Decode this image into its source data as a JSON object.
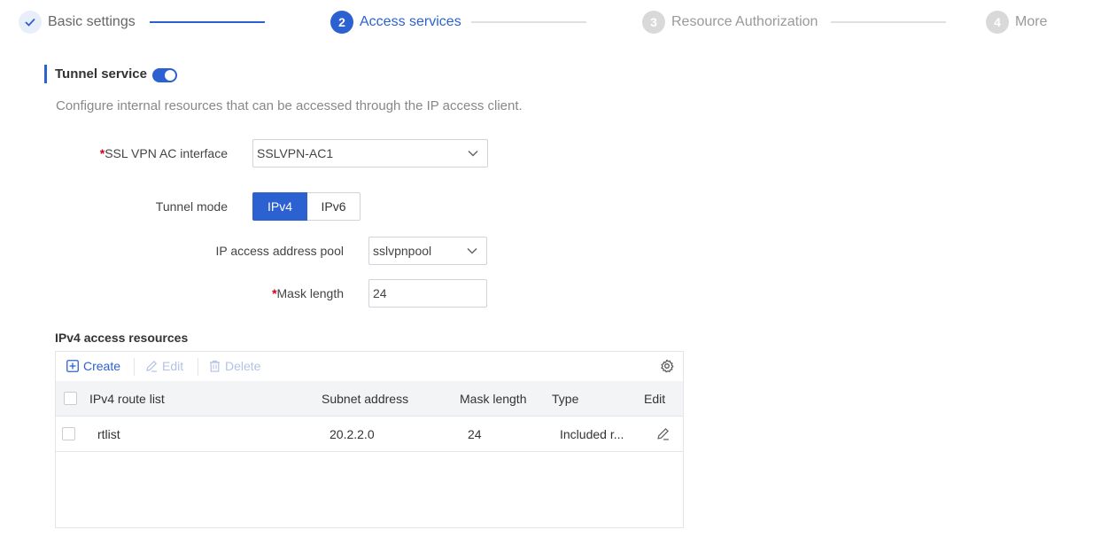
{
  "steps": [
    {
      "number": "",
      "label": "Basic settings",
      "state": "done"
    },
    {
      "number": "2",
      "label": "Access services",
      "state": "active"
    },
    {
      "number": "3",
      "label": "Resource Authorization",
      "state": "pending"
    },
    {
      "number": "4",
      "label": "More",
      "state": "pending"
    }
  ],
  "section": {
    "title": "Tunnel service",
    "toggle_on": true,
    "description": "Configure internal resources that can be accessed through the IP access client."
  },
  "form": {
    "required_mark": "*",
    "ac_interface": {
      "label": "SSL VPN AC interface",
      "value": "SSLVPN-AC1"
    },
    "tunnel_mode": {
      "label": "Tunnel mode",
      "options": [
        "IPv4",
        "IPv6"
      ],
      "selected": "IPv4"
    },
    "address_pool": {
      "label": "IP access address pool",
      "value": "sslvpnpool"
    },
    "mask_length": {
      "label": "Mask length",
      "value": "24"
    }
  },
  "table": {
    "title": "IPv4 access resources",
    "toolbar": {
      "create": "Create",
      "edit": "Edit",
      "delete": "Delete"
    },
    "columns": [
      "IPv4 route list",
      "Subnet address",
      "Mask length",
      "Type",
      "Edit"
    ],
    "rows": [
      {
        "route_list": "rtlist",
        "subnet": "20.2.2.0",
        "mask": "24",
        "type": "Included r..."
      }
    ]
  },
  "colors": {
    "accent": "#2b61d1",
    "required": "#d0021b",
    "disabled": "#b3c3e6"
  },
  "icons": [
    "check-icon",
    "chevron-down-icon",
    "plus-square-icon",
    "pencil-icon",
    "trash-icon",
    "gear-icon"
  ]
}
